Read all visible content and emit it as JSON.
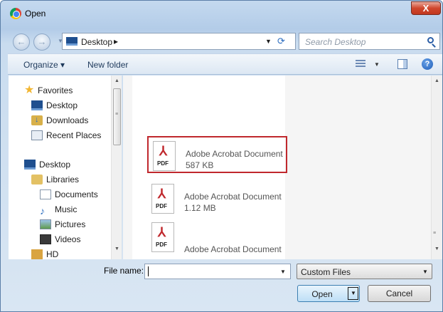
{
  "window": {
    "title": "Open",
    "close_glyph": "X"
  },
  "nav": {
    "back_glyph": "←",
    "forward_glyph": "→",
    "path_glyph": "▼"
  },
  "address": {
    "location": "Desktop",
    "separator": "▸",
    "dropdown": "▼",
    "refresh": "⟳"
  },
  "search": {
    "placeholder": "Search Desktop"
  },
  "toolbar": {
    "organize": "Organize ▾",
    "new_folder": "New folder",
    "view_dropdown": "▼",
    "help": "?"
  },
  "sidebar": {
    "favorites": "Favorites",
    "favorites_items": [
      "Desktop",
      "Downloads",
      "Recent Places"
    ],
    "desktop": "Desktop",
    "libraries": "Libraries",
    "library_items": [
      "Documents",
      "Music",
      "Pictures",
      "Videos"
    ],
    "hd": "HD"
  },
  "files": [
    {
      "name": "Adobe Acrobat Document",
      "size": "587 KB",
      "type": "PDF",
      "selected": true
    },
    {
      "name": "Adobe Acrobat Document",
      "size": "1.12 MB",
      "type": "PDF",
      "selected": false
    },
    {
      "name": "Adobe Acrobat Document",
      "size": "",
      "type": "PDF",
      "selected": false
    }
  ],
  "icons": {
    "app": "chrome-icon",
    "back": "back-arrow-icon",
    "forward": "forward-arrow-icon",
    "folder": "desktop-folder-icon",
    "refresh": "refresh-icon",
    "search": "magnifier-icon",
    "view": "view-list-icon",
    "preview": "preview-pane-icon",
    "help": "help-icon",
    "pdf": "pdf-icon"
  },
  "file_name": {
    "label": "File name:",
    "value": "",
    "dropdown": "▼"
  },
  "file_type": {
    "selected": "Custom Files",
    "dropdown": "▼"
  },
  "buttons": {
    "open": "Open",
    "open_split": "▼",
    "cancel": "Cancel"
  },
  "scroll_glyphs": {
    "up": "▲",
    "down": "▼",
    "grip": "≡"
  },
  "colors": {
    "selection_border": "#c0282d",
    "title_gradient": "#c4d9ef",
    "close": "#d0472d"
  }
}
